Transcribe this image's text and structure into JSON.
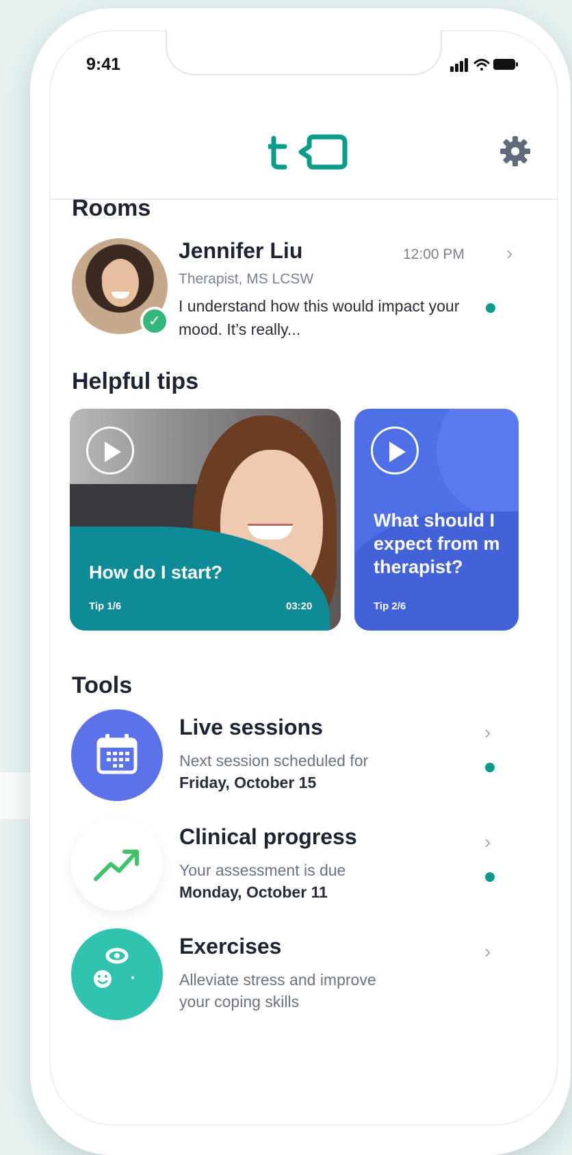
{
  "status_bar": {
    "time": "9:41"
  },
  "header": {
    "logo_icon": "talkspace-logo",
    "settings_icon": "gear-icon",
    "brand_color": "#0b9b8a"
  },
  "rooms": {
    "title": "Rooms",
    "items": [
      {
        "name": "Jennifer Liu",
        "role": "Therapist, MS LCSW",
        "time": "12:00 PM",
        "message": "I understand how this would impact your mood. It’s really...",
        "unread": true
      }
    ]
  },
  "tips": {
    "title": "Helpful tips",
    "items": [
      {
        "title": "How do I start?",
        "number": "Tip 1/6",
        "duration": "03:20",
        "color": "#0f8b97"
      },
      {
        "title_lines": [
          "What should I",
          "expect from m",
          "therapist?"
        ],
        "number": "Tip 2/6",
        "color": "#4f6fe6"
      }
    ]
  },
  "tools": {
    "title": "Tools",
    "items": [
      {
        "name": "Live sessions",
        "desc": "Next session scheduled for",
        "detail": "Friday, October 15",
        "unread": true,
        "icon": "calendar-icon",
        "color": "#5b72e8"
      },
      {
        "name": "Clinical progress",
        "desc": "Your assessment is due",
        "detail": "Monday, October 11",
        "unread": true,
        "icon": "trend-up-icon",
        "color": "#ffffff"
      },
      {
        "name": "Exercises",
        "desc": "Alleviate stress and improve",
        "detail": "your coping skills",
        "unread": false,
        "icon": "mindfulness-icon",
        "color": "#2fc3b0"
      }
    ]
  }
}
